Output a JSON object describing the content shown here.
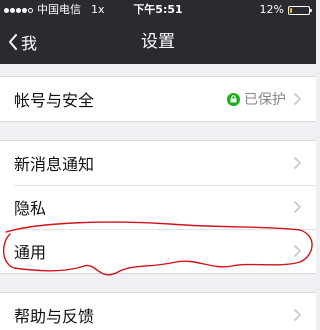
{
  "status_bar": {
    "carrier": "中国电信",
    "network": "1x",
    "time": "下午5:51",
    "battery_text": "12%",
    "battery_level": 0.12,
    "battery_color": "#f4c92d"
  },
  "nav": {
    "back_label": "我",
    "title": "设置"
  },
  "groups": [
    {
      "items": [
        {
          "label": "帐号与安全",
          "status_text": "已保护",
          "status_color": "#1aad19"
        }
      ]
    },
    {
      "items": [
        {
          "label": "新消息通知"
        },
        {
          "label": "隐私"
        },
        {
          "label": "通用"
        }
      ]
    },
    {
      "items": [
        {
          "label": "帮助与反馈"
        }
      ]
    }
  ],
  "colors": {
    "topbar": "#2a2b30",
    "background": "#efeff4",
    "annotation": "#d0141b"
  }
}
